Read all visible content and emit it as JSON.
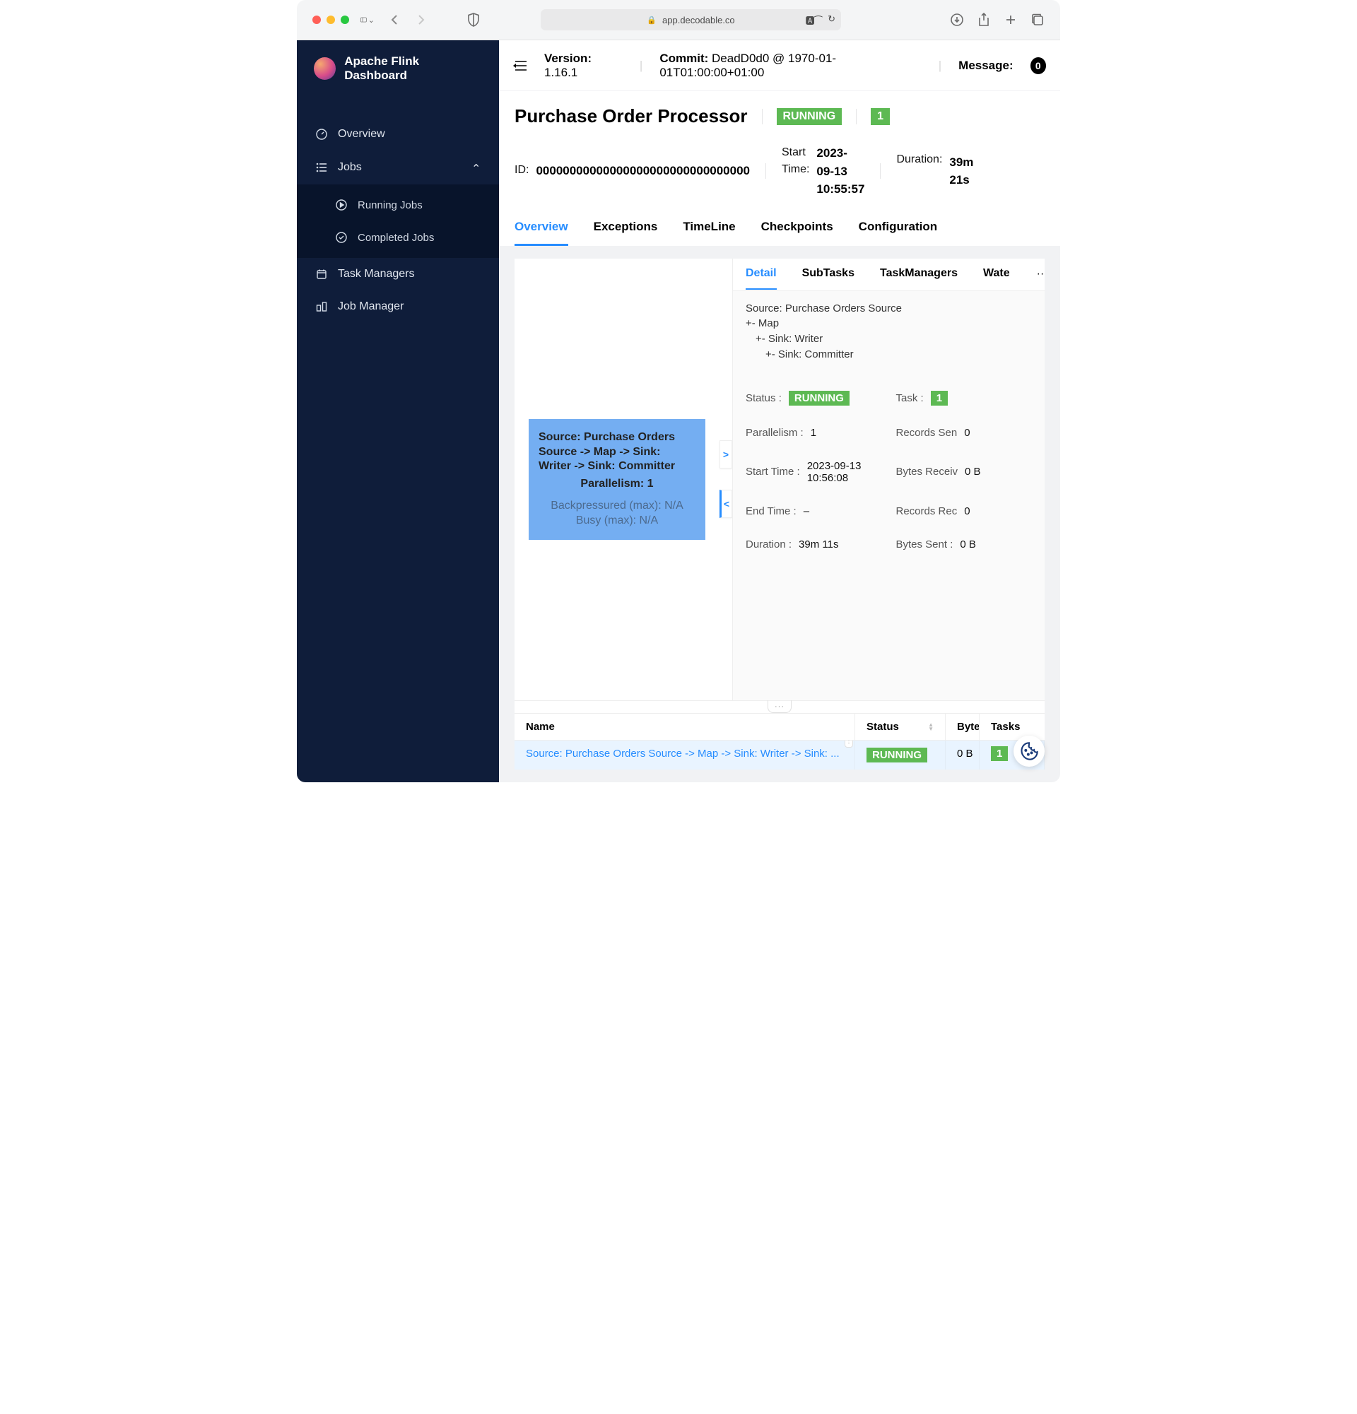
{
  "browser": {
    "url": "app.decodable.co"
  },
  "sidebar": {
    "title": "Apache Flink Dashboard",
    "overview": "Overview",
    "jobs": "Jobs",
    "running_jobs": "Running Jobs",
    "completed_jobs": "Completed Jobs",
    "task_managers": "Task Managers",
    "job_manager": "Job Manager"
  },
  "topbar": {
    "version_label": "Version:",
    "version_value": "1.16.1",
    "commit_label": "Commit:",
    "commit_value": "DeadD0d0 @ 1970-01-01T01:00:00+01:00",
    "message_label": "Message:",
    "message_count": "0"
  },
  "job": {
    "title": "Purchase Order Processor",
    "status": "RUNNING",
    "count": "1",
    "id_label": "ID:",
    "id_value": "00000000000000000000000000000000",
    "start_label_1": "Start",
    "start_label_2": "Time:",
    "start_value_1": "2023-",
    "start_value_2": "09-13",
    "start_value_3": "10:55:57",
    "duration_label": "Duration:",
    "duration_value_1": "39m",
    "duration_value_2": "21s"
  },
  "tabs": [
    "Overview",
    "Exceptions",
    "TimeLine",
    "Checkpoints",
    "Configuration"
  ],
  "graph": {
    "title": "Source: Purchase Orders Source -> Map -> Sink: Writer -> Sink: Committer",
    "parallelism": "Parallelism: 1",
    "backpressure": "Backpressured (max): N/A",
    "busy": "Busy (max): N/A"
  },
  "detail_tabs": [
    "Detail",
    "SubTasks",
    "TaskManagers",
    "Wate"
  ],
  "detail_tree": {
    "l0": "Source: Purchase Orders Source",
    "l1": "+- Map",
    "l2": "+- Sink: Writer",
    "l3": "+- Sink: Committer"
  },
  "detail_kv": {
    "status_k": "Status :",
    "status_v": "RUNNING",
    "task_k": "Task :",
    "task_v": "1",
    "parallelism_k": "Parallelism :",
    "parallelism_v": "1",
    "records_sent_k": "Records Sen",
    "records_sent_v": "0",
    "start_time_k": "Start Time :",
    "start_time_v": "2023-09-13 10:56:08",
    "bytes_recv_k": "Bytes Receiv",
    "bytes_recv_v": "0 B",
    "end_time_k": "End Time :",
    "end_time_v": "–",
    "records_recv_k": "Records Rec",
    "records_recv_v": "0",
    "duration_k": "Duration :",
    "duration_v": "39m 11s",
    "bytes_sent_k": "Bytes Sent :",
    "bytes_sent_v": "0 B"
  },
  "table": {
    "header_name": "Name",
    "header_status": "Status",
    "header_bytes": "Byte",
    "header_tasks": "Tasks",
    "row_name": "Source: Purchase Orders Source -> Map -> Sink: Writer -> Sink: ...",
    "row_status": "RUNNING",
    "row_bytes": "0 B",
    "row_tasks": "1"
  }
}
